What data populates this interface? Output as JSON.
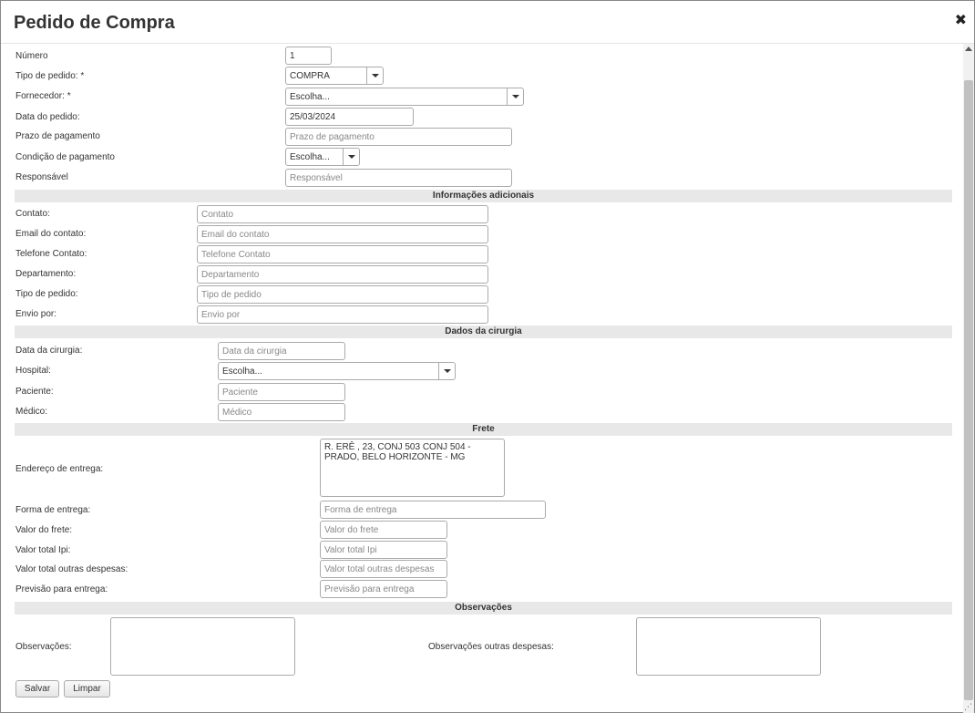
{
  "dialog": {
    "title": "Pedido de Compra"
  },
  "main": {
    "numero": {
      "label": "Número",
      "value": "1"
    },
    "tipo_pedido": {
      "label": "Tipo de pedido:",
      "required": "*",
      "value": "COMPRA"
    },
    "fornecedor": {
      "label": "Fornecedor:",
      "required": "*",
      "value": "Escolha..."
    },
    "data_pedido": {
      "label": "Data do pedido:",
      "value": "25/03/2024"
    },
    "prazo_pagamento": {
      "label": "Prazo de pagamento",
      "placeholder": "Prazo de pagamento"
    },
    "condicao_pagamento": {
      "label": "Condição de pagamento",
      "value": "Escolha..."
    },
    "responsavel": {
      "label": "Responsável",
      "placeholder": "Responsável"
    }
  },
  "info": {
    "title": "Informações adicionais",
    "contato": {
      "label": "Contato:",
      "placeholder": "Contato"
    },
    "email": {
      "label": "Email do contato:",
      "placeholder": "Email do contato"
    },
    "telefone": {
      "label": "Telefone Contato:",
      "placeholder": "Telefone Contato"
    },
    "departamento": {
      "label": "Departamento:",
      "placeholder": "Departamento"
    },
    "tipo_pedido": {
      "label": "Tipo de pedido:",
      "placeholder": "Tipo de pedido"
    },
    "envio": {
      "label": "Envio por:",
      "placeholder": "Envio por"
    }
  },
  "cirurgia": {
    "title": "Dados da cirurgia",
    "data": {
      "label": "Data da cirurgia:",
      "placeholder": "Data da cirurgia"
    },
    "hospital": {
      "label": "Hospital:",
      "value": "Escolha..."
    },
    "paciente": {
      "label": "Paciente:",
      "placeholder": "Paciente"
    },
    "medico": {
      "label": "Médico:",
      "placeholder": "Médico"
    }
  },
  "frete": {
    "title": "Frete",
    "endereco": {
      "label": "Endereço de entrega:",
      "value": "R. ERÊ , 23, CONJ 503 CONJ 504 - PRADO, BELO HORIZONTE - MG"
    },
    "forma": {
      "label": "Forma de entrega:",
      "placeholder": "Forma de entrega"
    },
    "valor_frete": {
      "label": "Valor do frete:",
      "placeholder": "Valor do frete"
    },
    "valor_ipi": {
      "label": "Valor total Ipi:",
      "placeholder": "Valor total Ipi"
    },
    "valor_outras": {
      "label": "Valor total outras despesas:",
      "placeholder": "Valor total outras despesas"
    },
    "previsao": {
      "label": "Previsão para entrega:",
      "placeholder": "Previsão para entrega"
    }
  },
  "observacoes": {
    "title": "Observações",
    "obs": {
      "label": "Observações:",
      "value": ""
    },
    "obs_outras": {
      "label": "Observações outras despesas:",
      "value": ""
    }
  },
  "actions": {
    "save_label": "Salvar",
    "clear_label": "Limpar"
  },
  "icons": {
    "close": "close-icon",
    "dropdown": "chevron-down-icon",
    "resize": "resize-grip-icon"
  }
}
